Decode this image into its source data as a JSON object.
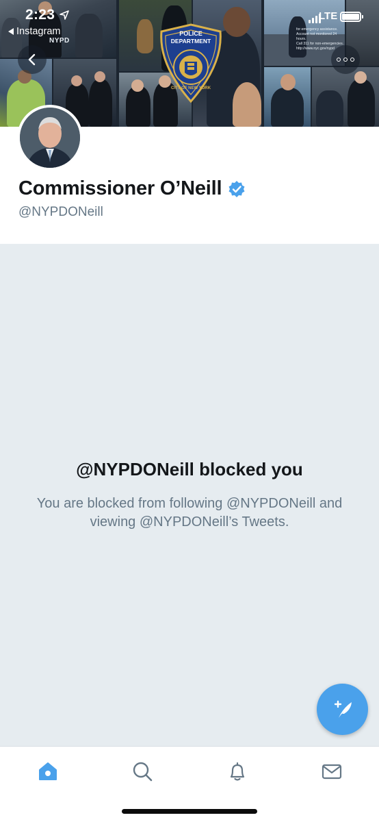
{
  "status_bar": {
    "time": "2:23",
    "back_app": "Instagram",
    "network": "LTE"
  },
  "banner": {
    "jacket_text": "NYPD",
    "badge": {
      "line1": "POLICE",
      "line2": "DEPARTMENT",
      "arc_text": "CITY OF NEW YORK"
    },
    "note_lines": [
      "for emergency assistance.",
      "Account not monitored 24 hours.",
      "Call 311 for non-emergencies.",
      "http://www.nyc.gov/nypd"
    ]
  },
  "profile": {
    "display_name": "Commissioner O’Neill",
    "handle": "@NYPDONeill",
    "verified": true
  },
  "blocked": {
    "title": "@NYPDONeill blocked you",
    "message": "You are blocked from following @NYPDONeill and viewing @NYPDONeill’s Tweets."
  },
  "tabs": [
    {
      "name": "home",
      "icon": "home-icon",
      "active": true
    },
    {
      "name": "search",
      "icon": "search-icon",
      "active": false
    },
    {
      "name": "notifications",
      "icon": "bell-icon",
      "active": false
    },
    {
      "name": "messages",
      "icon": "envelope-icon",
      "active": false
    }
  ],
  "colors": {
    "accent": "#4aa1eb",
    "panel_bg": "#e6ecf0",
    "text_primary": "#14171a",
    "text_secondary": "#657786"
  }
}
